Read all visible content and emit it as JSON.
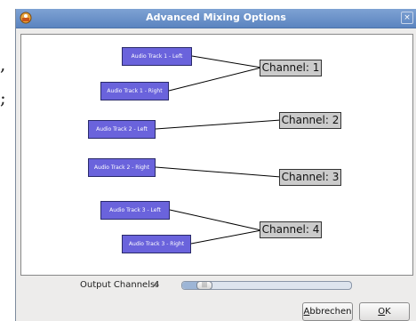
{
  "window": {
    "title": "Advanced Mixing Options",
    "close_glyph": "×"
  },
  "stray_text": {
    "top": ",",
    "bottom": ";"
  },
  "tracks": [
    {
      "label": "Audio Track 1 - Left"
    },
    {
      "label": "Audio Track 1 - Right"
    },
    {
      "label": "Audio Track 2 - Left"
    },
    {
      "label": "Audio Track 2 - Right"
    },
    {
      "label": "Audio Track 3 - Left"
    },
    {
      "label": "Audio Track 3 - Right"
    }
  ],
  "channels": [
    {
      "label": "Channel:  1"
    },
    {
      "label": "Channel:  2"
    },
    {
      "label": "Channel:  3"
    },
    {
      "label": "Channel:  4"
    }
  ],
  "output": {
    "label": "Output Channels:",
    "value": "4",
    "slider_fraction": 0.08,
    "thumb_glyph": "|||"
  },
  "buttons": {
    "cancel_mnemonic": "A",
    "cancel_rest": "bbrechen",
    "ok_mnemonic": "O",
    "ok_rest": "K"
  },
  "colors": {
    "titlebar": "#6e94c9",
    "track_fill": "#6a63dc",
    "channel_fill": "#cbcbcb"
  }
}
